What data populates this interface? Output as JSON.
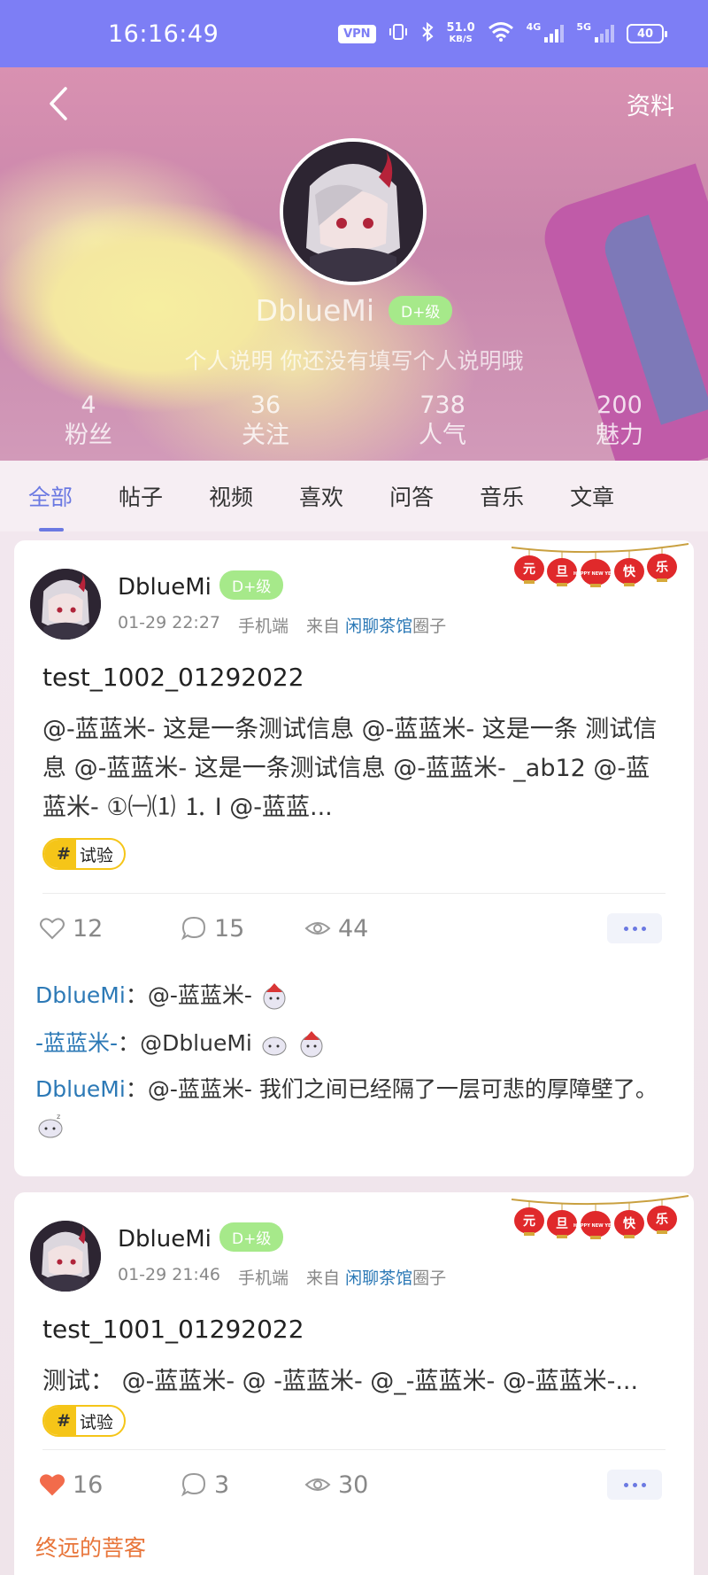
{
  "status_bar": {
    "time": "16:16:49",
    "vpn": "VPN",
    "speed_value": "51.0",
    "speed_unit": "KB/S",
    "net1": "4G",
    "net2": "5G",
    "battery": "40"
  },
  "header": {
    "info_link": "资料",
    "name": "DblueMi",
    "level": "D+级",
    "bio": "个人说明   你还没有填写个人说明哦"
  },
  "stats": [
    {
      "num": "4",
      "label": "粉丝"
    },
    {
      "num": "36",
      "label": "关注"
    },
    {
      "num": "738",
      "label": "人气"
    },
    {
      "num": "200",
      "label": "魅力"
    }
  ],
  "tabs": [
    "全部",
    "帖子",
    "视频",
    "喜欢",
    "问答",
    "音乐",
    "文章"
  ],
  "posts": [
    {
      "author": "DblueMi",
      "level": "D+级",
      "time": "01-29 22:27",
      "device": "手机端",
      "from": "来自",
      "circle": "闲聊茶馆",
      "circle_suffix": "圈子",
      "title": "test_1002_01292022",
      "body": "@-蓝蓝米- 这是一条测试信息 @-蓝蓝米- 这是一条 测试信息 @-蓝蓝米- 这是一条测试信息 @-蓝蓝米- _ab12 @-蓝蓝米- ①㈠⑴ ⒈ Ⅰ @-蓝蓝...",
      "tag": "试验",
      "likes": "12",
      "comments_count": "15",
      "views": "44",
      "comments": [
        {
          "name": "DblueMi",
          "sep": "：",
          "text": "@-蓝蓝米-"
        },
        {
          "name": "-蓝蓝米-",
          "sep": "：",
          "text": "@DblueMi"
        },
        {
          "name": "DblueMi",
          "sep": "：",
          "text": "@-蓝蓝米- 我们之间已经隔了一层可悲的厚障壁了。"
        }
      ]
    },
    {
      "author": "DblueMi",
      "level": "D+级",
      "time": "01-29 21:46",
      "device": "手机端",
      "from": "来自",
      "circle": "闲聊茶馆",
      "circle_suffix": "圈子",
      "title": "test_1001_01292022",
      "body": "测试： @-蓝蓝米- @ -蓝蓝米- @_-蓝蓝米- @-蓝蓝米-...",
      "tag": "试验",
      "likes": "16",
      "comments_count": "3",
      "views": "30",
      "comment_partial": "终远的菩客"
    }
  ],
  "lantern_chars": [
    "元",
    "旦",
    "HAPPY NEW YEAR",
    "快",
    "乐"
  ],
  "colors": {
    "status_bar": "#7d7ef5",
    "accent": "#6b79e2",
    "level_badge": "#a6e98a",
    "tag": "#f5c518",
    "link": "#2c79b6",
    "liked_heart": "#f26b4b"
  }
}
